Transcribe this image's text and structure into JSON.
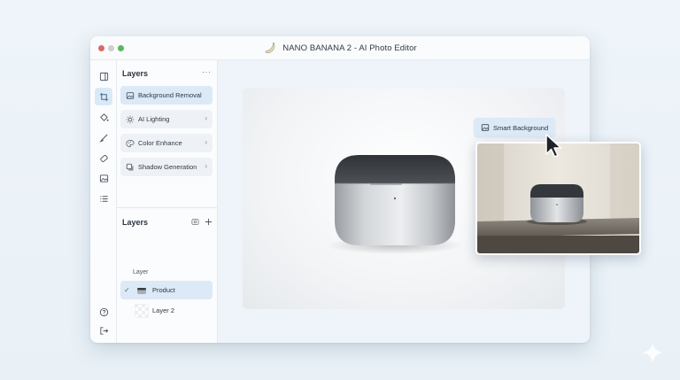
{
  "window": {
    "title": "NANO BANANA 2 - AI Photo Editor",
    "logo_icon": "banana-icon"
  },
  "toolbar": {
    "tools": [
      {
        "name": "panel-toggle-icon"
      },
      {
        "name": "crop-icon",
        "active": true
      },
      {
        "name": "fill-bucket-icon"
      },
      {
        "name": "brush-icon"
      },
      {
        "name": "eraser-icon"
      },
      {
        "name": "image-icon"
      },
      {
        "name": "list-icon"
      }
    ],
    "bottom": [
      {
        "name": "help-icon"
      },
      {
        "name": "logout-icon"
      }
    ]
  },
  "panel": {
    "title": "Layers",
    "more_label": "···",
    "features": [
      {
        "label": "Background Removal",
        "icon": "image-icon",
        "selected": true
      },
      {
        "label": "AI Lighting",
        "icon": "sun-icon"
      },
      {
        "label": "Color Enhance",
        "icon": "palette-icon"
      },
      {
        "label": "Shadow Generation",
        "icon": "shadow-icon"
      }
    ],
    "chevron": "›"
  },
  "layers": {
    "title": "Layers",
    "sub_label": "Layer",
    "check": "✓",
    "items": [
      {
        "name": "Product",
        "checked": true
      },
      {
        "name": "Layer 2"
      }
    ]
  },
  "canvas": {
    "smart_background_label": "Smart Background"
  },
  "colors": {
    "accent": "#dce9f6",
    "window_red": "#d96b64",
    "window_green": "#58b85c"
  }
}
